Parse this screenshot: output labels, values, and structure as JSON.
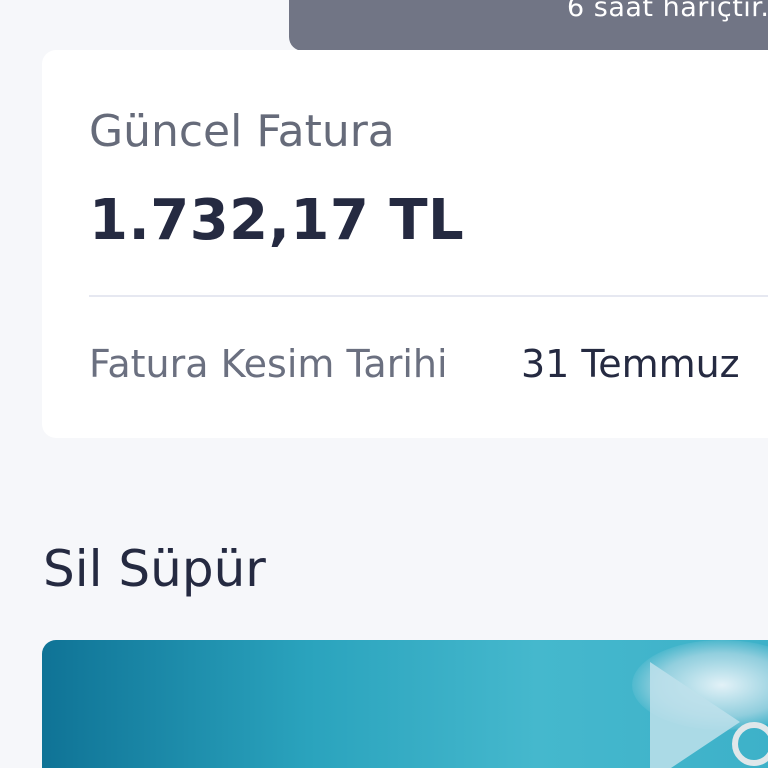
{
  "tooltip": {
    "text": "6 saat hariçtir."
  },
  "bill_card": {
    "label": "Güncel Fatura",
    "amount": "1.732,17 TL",
    "date_label": "Fatura Kesim Tarihi",
    "date_value": "31 Temmuz"
  },
  "section": {
    "title": "Sil Süpür"
  },
  "colors": {
    "background": "#f6f7fa",
    "card": "#ffffff",
    "tooltip_bg": "#717585",
    "text_dark": "#252a41",
    "text_muted": "#666b7a",
    "banner_start": "#0f7396",
    "banner_end": "#45b8cd"
  }
}
